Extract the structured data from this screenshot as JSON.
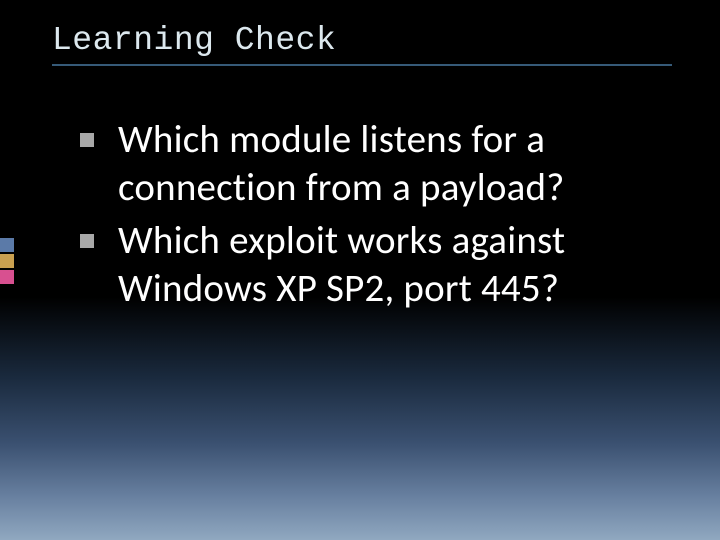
{
  "slide": {
    "title": "Learning Check",
    "bullets": [
      "Which module listens for a connection from a payload?",
      "Which exploit works against Windows XP SP2, port 445?"
    ]
  }
}
